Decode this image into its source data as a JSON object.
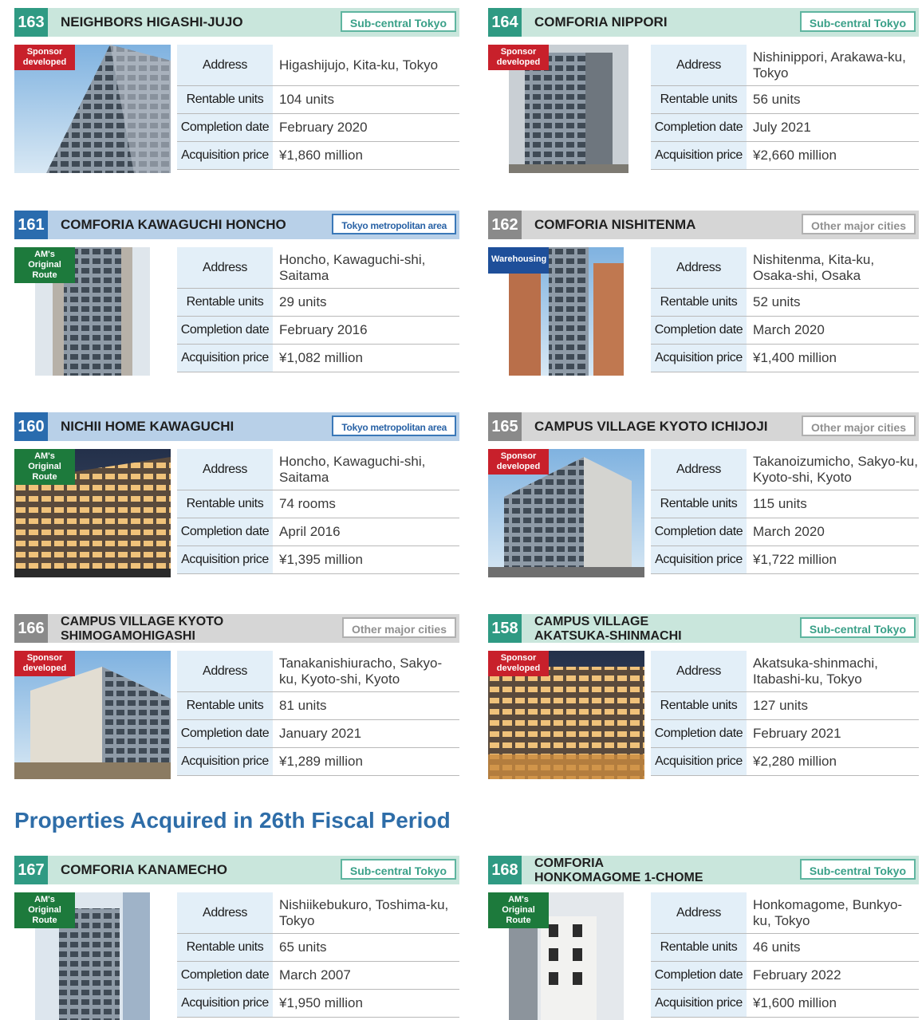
{
  "labels": {
    "address": "Address",
    "units": "Rentable units",
    "completion": "Completion date",
    "price": "Acquisition price"
  },
  "section_title": "Properties Acquired in 26th Fiscal Period",
  "properties": [
    {
      "number": "163",
      "name": "NEIGHBORS HIGASHI-JUJO",
      "area": "Sub-central Tokyo",
      "badge": "Sponsor\ndeveloped",
      "address": "Higashijujo, Kita-ku, Tokyo",
      "units": "104 units",
      "completion": "February 2020",
      "price": "¥1,860 million"
    },
    {
      "number": "164",
      "name": "COMFORIA NIPPORI",
      "area": "Sub-central Tokyo",
      "badge": "Sponsor\ndeveloped",
      "address": "Nishinippori, Arakawa-ku, Tokyo",
      "units": "56 units",
      "completion": "July 2021",
      "price": "¥2,660 million"
    },
    {
      "number": "161",
      "name": "COMFORIA KAWAGUCHI HONCHO",
      "area": "Tokyo metropolitan area",
      "badge": "AM's Original\nRoute",
      "address": "Honcho, Kawaguchi-shi, Saitama",
      "units": "29 units",
      "completion": "February 2016",
      "price": "¥1,082 million"
    },
    {
      "number": "162",
      "name": "COMFORIA NISHITENMA",
      "area": "Other major cities",
      "badge": "Warehousing",
      "address": "Nishitenma, Kita-ku, Osaka-shi, Osaka",
      "units": "52 units",
      "completion": "March 2020",
      "price": "¥1,400 million"
    },
    {
      "number": "160",
      "name": "NICHII HOME KAWAGUCHI",
      "area": "Tokyo metropolitan area",
      "badge": "AM's Original\nRoute",
      "address": "Honcho, Kawaguchi-shi, Saitama",
      "units": "74 rooms",
      "completion": "April 2016",
      "price": "¥1,395 million"
    },
    {
      "number": "165",
      "name": "CAMPUS VILLAGE KYOTO ICHIJOJI",
      "area": "Other major cities",
      "badge": "Sponsor\ndeveloped",
      "address": "Takanoizumicho, Sakyo-ku, Kyoto-shi, Kyoto",
      "units": "115 units",
      "completion": "March 2020",
      "price": "¥1,722 million"
    },
    {
      "number": "166",
      "name": "CAMPUS VILLAGE KYOTO\nSHIMOGAMOHIGASHI",
      "area": "Other major cities",
      "badge": "Sponsor\ndeveloped",
      "address": "Tanakanishiuracho, Sakyo-ku, Kyoto-shi, Kyoto",
      "units": "81 units",
      "completion": "January 2021",
      "price": "¥1,289 million"
    },
    {
      "number": "158",
      "name": "CAMPUS VILLAGE\nAKATSUKA-SHINMACHI",
      "area": "Sub-central Tokyo",
      "badge": "Sponsor\ndeveloped",
      "address": "Akatsuka-shinmachi, Itabashi-ku, Tokyo",
      "units": "127 units",
      "completion": "February 2021",
      "price": "¥2,280 million"
    },
    {
      "number": "167",
      "name": "COMFORIA KANAMECHO",
      "area": "Sub-central Tokyo",
      "badge": "AM's Original\nRoute",
      "address": "Nishiikebukuro, Toshima-ku, Tokyo",
      "units": "65 units",
      "completion": "March 2007",
      "price": "¥1,950 million"
    },
    {
      "number": "168",
      "name": "COMFORIA\nHONKOMAGOME 1-CHOME",
      "area": "Sub-central Tokyo",
      "badge": "AM's Original\nRoute",
      "address": "Honkomagome, Bunkyo-ku, Tokyo",
      "units": "46 units",
      "completion": "February 2022",
      "price": "¥1,600 million"
    }
  ],
  "colors": {
    "sub_central_accent": "#2f9a83",
    "metropolitan_accent": "#2a6cae",
    "other_cities_accent": "#8a8a8a",
    "sponsor_badge": "#c8202b",
    "am_route_badge": "#1d7a3c",
    "warehousing_badge": "#1e4f9a",
    "section_title": "#2e6da8"
  }
}
